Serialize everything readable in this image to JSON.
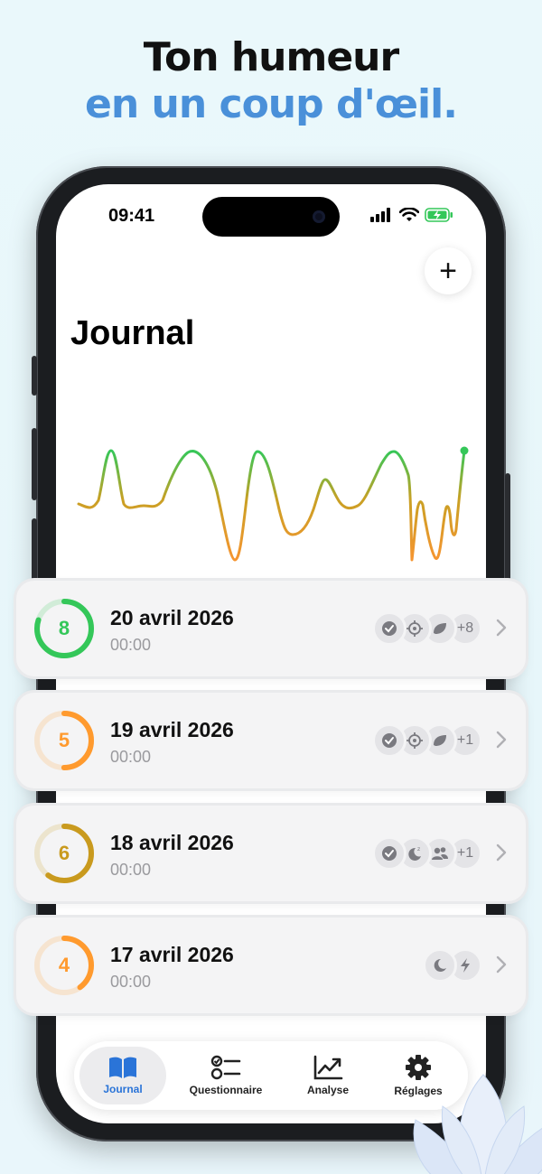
{
  "headline": {
    "line1": "Ton humeur",
    "line2": "en un coup d'œil."
  },
  "status_bar": {
    "time": "09:41"
  },
  "page": {
    "title": "Journal",
    "add_label": "+"
  },
  "entries": [
    {
      "score": "8",
      "date": "20 avril 2026",
      "time": "00:00",
      "color": "#34c759",
      "fraction": 0.8,
      "tags": [
        "check-icon",
        "target-icon",
        "leaf-icon"
      ],
      "more": "+8"
    },
    {
      "score": "5",
      "date": "19 avril 2026",
      "time": "00:00",
      "color": "#ff9a2e",
      "fraction": 0.5,
      "tags": [
        "check-icon",
        "target-icon",
        "leaf-icon"
      ],
      "more": "+1"
    },
    {
      "score": "6",
      "date": "18 avril 2026",
      "time": "00:00",
      "color": "#c99a1e",
      "fraction": 0.6,
      "tags": [
        "check-icon",
        "sleep-icon",
        "people-icon"
      ],
      "more": "+1"
    },
    {
      "score": "4",
      "date": "17 avril 2026",
      "time": "00:00",
      "color": "#ff9a2e",
      "fraction": 0.4,
      "tags": [
        "moon-icon",
        "bolt-icon"
      ],
      "more": ""
    }
  ],
  "tab_bar": {
    "journal": "Journal",
    "questionnaire": "Questionnaire",
    "analyse": "Analyse",
    "reglages": "Réglages"
  },
  "colors": {
    "accent": "#2a74d8",
    "headline_blue": "#4a90d9",
    "mood_green": "#34c759",
    "mood_orange": "#f0a030"
  }
}
